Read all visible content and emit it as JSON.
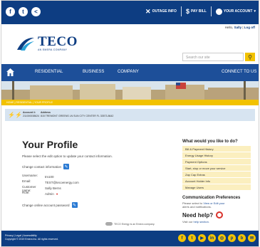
{
  "topbar": {
    "social_icons": [
      "facebook-icon",
      "twitter-icon",
      "share-icon"
    ],
    "outage_label": "OUTAGE INFO",
    "pay_label": "PAY BILL",
    "account_label": "YOUR ACCOUNT"
  },
  "header": {
    "logo_text": "TECO",
    "logo_tagline": "AN EMERA COMPANY",
    "hello_prefix": "Hello,",
    "user_name": "Sally",
    "logoff": "Log off",
    "search_placeholder": "Search our site"
  },
  "nav": {
    "items": [
      "RESIDENTIAL",
      "BUSINESS",
      "COMPANY"
    ],
    "right": "CONNECT TO US"
  },
  "breadcrumb": "HOME | RESIDENTIAL | YOUR PROFILE",
  "account": {
    "number_label": "Account #:",
    "number": "211000038624",
    "address_label": "Address",
    "address": "815 TREMONT GREENS LN SUN CITY CENTER FL 33573-8642"
  },
  "profile": {
    "title": "Your Profile",
    "intro": "Please select the edit option to update your contact information.",
    "change_contact": "Change contact information",
    "fields": [
      {
        "label": "Username:",
        "value": "tm100"
      },
      {
        "label": "Email:",
        "value": "TEST@tecoenergy.com"
      },
      {
        "label": "Customer name:",
        "value": "Sally Berns"
      },
      {
        "label": "Role:",
        "value": "Admin"
      }
    ],
    "change_password": "Change online account password"
  },
  "sidebar": {
    "heading": "What would you like to do?",
    "items": [
      "Bill & Payment History",
      "Energy Usage History",
      "Payment Options",
      "Start, stop or move your service",
      "Zap Cap Extras",
      "Account Holder Info",
      "Manage Users"
    ],
    "comm_heading": "Communication Preferences",
    "comm_text_1": "Please select to",
    "comm_link": "View or Edit your",
    "comm_text_2": "alerts and notifications.",
    "help_heading": "Need help?",
    "help_text": "Visit our",
    "help_link": "help section."
  },
  "partner": "TECO Energy is an Emera company.",
  "footer": {
    "line1": "Privacy | Legal | Accessibility",
    "line2": "Copyright © 2019 Emera Inc. All rights reserved.",
    "icons": [
      "facebook-icon",
      "twitter-icon",
      "youtube-icon",
      "linkedin-icon",
      "instagram-icon",
      "pinterest-icon",
      "blog-icon",
      "email-icon"
    ]
  },
  "colors": {
    "navy": "#0d3d82",
    "nav_blue": "#1d4f99",
    "yellow": "#f2c200",
    "account_bg": "#d7e4f1",
    "menu_bg": "#fbefbf"
  }
}
